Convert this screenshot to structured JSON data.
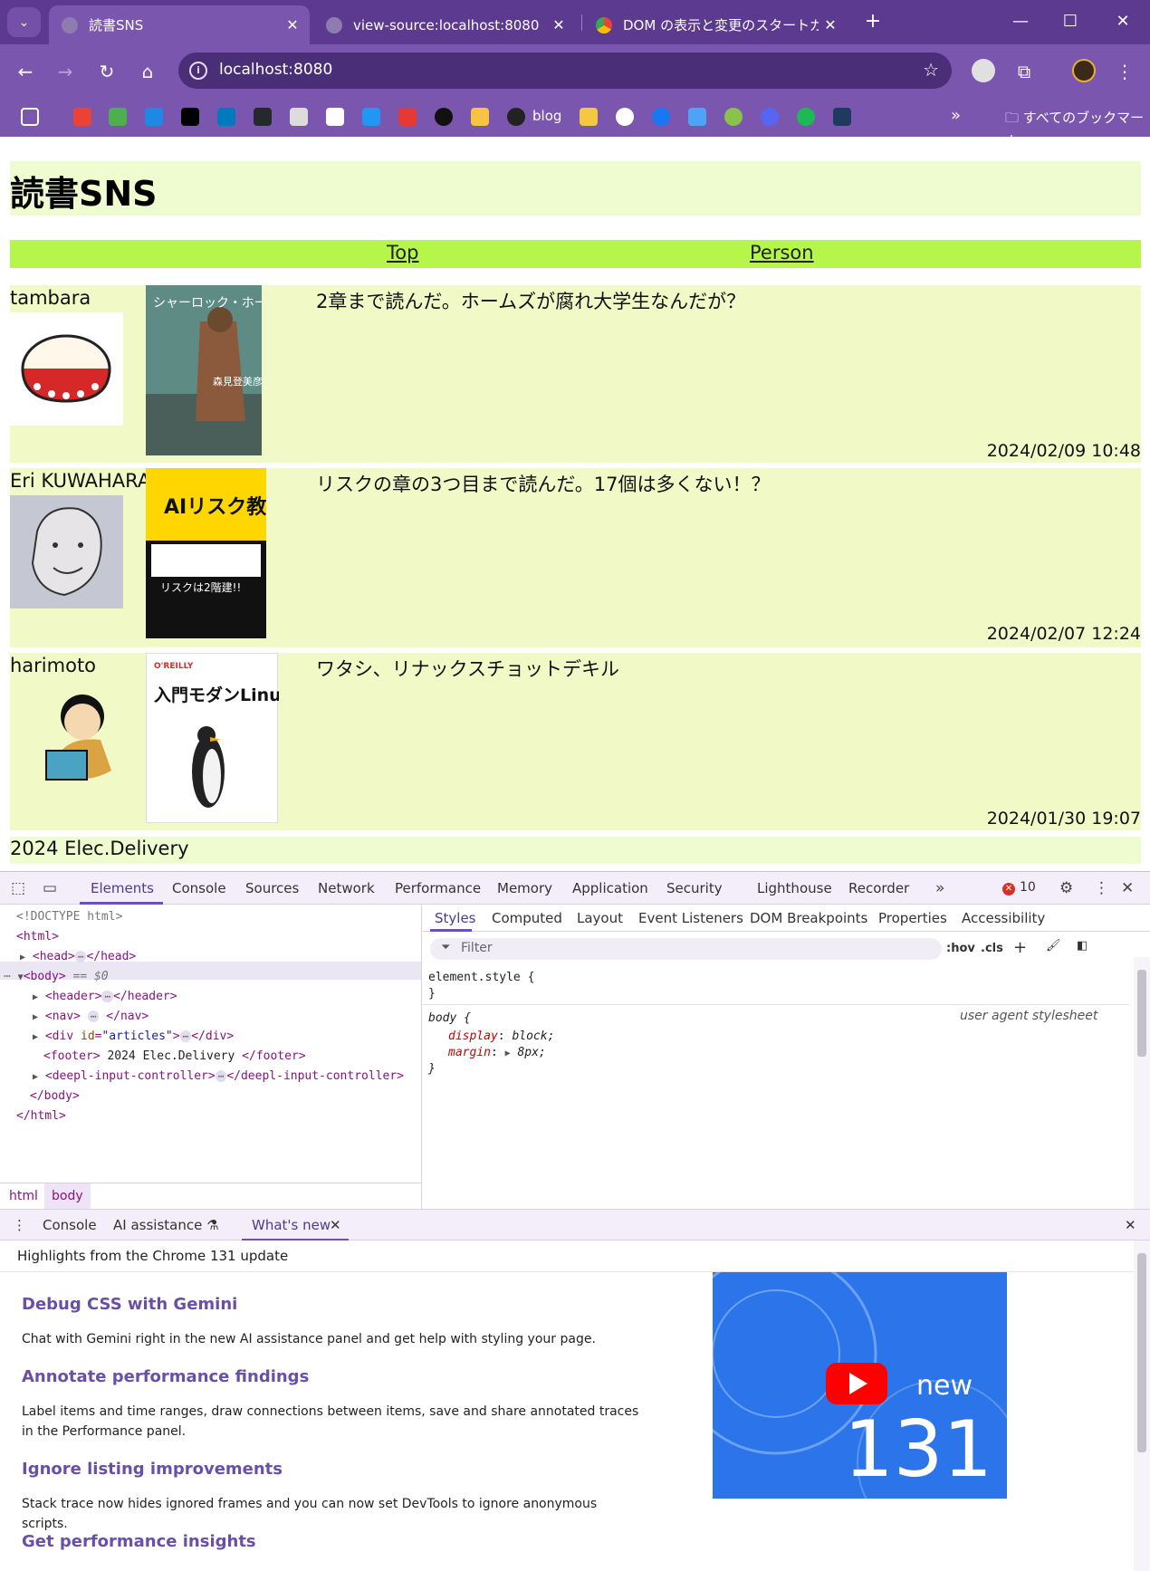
{
  "browser": {
    "tabs": [
      {
        "title": "読書SNS",
        "close": "✕"
      },
      {
        "title": "view-source:localhost:8080",
        "close": "✕"
      },
      {
        "title": "DOM の表示と変更のスタートガイド",
        "close": "✕"
      }
    ],
    "new_tab": "+",
    "window_controls": {
      "minimize": "—",
      "maximize": "☐",
      "close": "✕"
    },
    "url": "localhost:8080",
    "bookmarks_visible_label": "blog",
    "all_bookmarks_label": "すべてのブックマーク",
    "more_label": "»"
  },
  "page": {
    "title": "読書SNS",
    "nav": [
      {
        "label": "Top"
      },
      {
        "label": "Person"
      }
    ],
    "articles": [
      {
        "user": "tambara",
        "text": "2章まで読んだ。ホームズが腐れ大学生なんだが？",
        "date": "2024/02/09 10:48",
        "book_title": "シャーロック・ホームズの凱旋",
        "book_author": "森見登美彦"
      },
      {
        "user": "Eri KUWAHARA",
        "text": "リスクの章の3つ目まで読んだ。17個は多くない！？",
        "date": "2024/02/07 12:24",
        "book_title": "AIリスク教本",
        "book_banner": "リスクは2階建!!"
      },
      {
        "user": "harimoto",
        "text": "ワタシ、リナックスチョットデキル",
        "date": "2024/01/30 19:07",
        "book_title": "入門モダンLinux",
        "book_publisher": "O'REILLY"
      }
    ],
    "footer": "2024 Elec.Delivery"
  },
  "devtools": {
    "tabs": [
      "Elements",
      "Console",
      "Sources",
      "Network",
      "Performance",
      "Memory",
      "Application",
      "Security",
      "Lighthouse",
      "Recorder"
    ],
    "error_count": "10",
    "dom": {
      "doctype": "<!DOCTYPE html>",
      "html_open": "<html>",
      "head": "head",
      "body": "body",
      "body_marker": "== $0",
      "header": "header",
      "nav": "nav",
      "div_attr": "id",
      "div_val": "\"articles\"",
      "footer_text": " 2024 Elec.Delivery ",
      "deepl": "deepl-input-controller",
      "body_close": "</body>",
      "html_close": "</html>"
    },
    "breadcrumbs": [
      "html",
      "body"
    ],
    "styles_tabs": [
      "Styles",
      "Computed",
      "Layout",
      "Event Listeners",
      "DOM Breakpoints",
      "Properties",
      "Accessibility"
    ],
    "filter_placeholder": "Filter",
    "style_tools": {
      "hov": ":hov",
      "cls": ".cls"
    },
    "rules": {
      "element_style": "element.style {",
      "close": "}",
      "body_selector": "body {",
      "ua_label": "user agent stylesheet",
      "display_prop": "display",
      "display_val": "block;",
      "margin_prop": "margin",
      "margin_val": "8px;"
    },
    "drawer_tabs": [
      "Console",
      "AI assistance",
      "What's new"
    ],
    "whats_new": {
      "highlight": "Highlights from the Chrome 131 update",
      "items": [
        {
          "heading": "Debug CSS with Gemini",
          "body": "Chat with Gemini right in the new AI assistance panel and get help with styling your page."
        },
        {
          "heading": "Annotate performance findings",
          "body": "Label items and time ranges, draw connections between items, save and share annotated traces in the Performance panel."
        },
        {
          "heading": "Ignore listing improvements",
          "body": "Stack trace now hides ignored frames and you can now set DevTools to ignore anonymous scripts."
        },
        {
          "heading": "Get performance insights",
          "body": ""
        }
      ],
      "video_badge": "new",
      "video_version": "131"
    }
  },
  "colors": {
    "chrome_dark": "#5b3a8f",
    "chrome_mid": "#7a56ae",
    "header_bg": "#eefcd0",
    "nav_bg": "#b6f54a",
    "article_bg": "#f1fac6",
    "devtools_accent": "#6b4fbf"
  }
}
